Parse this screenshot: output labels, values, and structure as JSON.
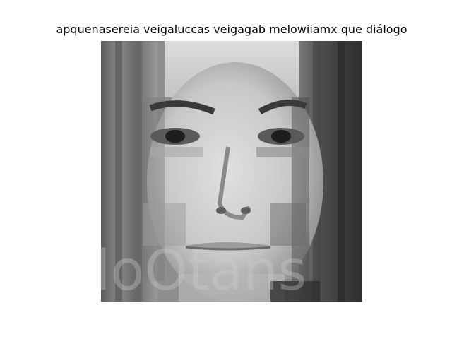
{
  "figure": {
    "title": "apquenasereia veigaluccas veigagab melowiiamx que diálogo"
  },
  "image": {
    "description_icon": "grayscale-face-photo",
    "watermark_text": "loOtans",
    "palette": {
      "hair_dark": "#3a3a3a",
      "hair_mid": "#6e6e6e",
      "skin_light": "#d9d9d9",
      "skin_mid": "#b8b8b8",
      "shadow": "#555555",
      "background_light": "#e8e8e8"
    }
  }
}
